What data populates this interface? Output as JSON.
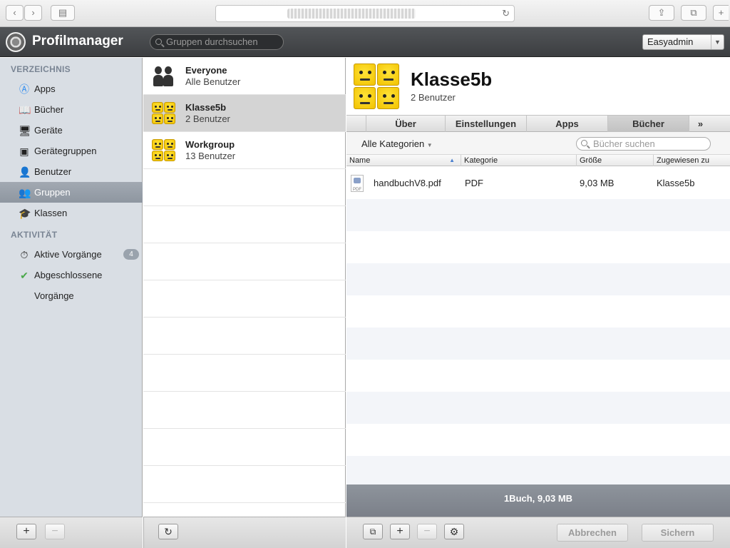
{
  "app": {
    "title": "Profilmanager",
    "search_placeholder": "Gruppen durchsuchen",
    "user": "Easyadmin"
  },
  "sidebar": {
    "sections": [
      {
        "label": "VERZEICHNIS"
      },
      {
        "label": "AKTIVITÄT"
      }
    ],
    "items": [
      {
        "label": "Apps",
        "icon": "app-store-icon"
      },
      {
        "label": "Bücher",
        "icon": "book-icon"
      },
      {
        "label": "Geräte",
        "icon": "monitor-icon"
      },
      {
        "label": "Gerätegruppen",
        "icon": "device-groups-icon"
      },
      {
        "label": "Benutzer",
        "icon": "user-icon"
      },
      {
        "label": "Gruppen",
        "icon": "group-icon",
        "selected": true
      },
      {
        "label": "Klassen",
        "icon": "graduation-cap-icon"
      },
      {
        "label": "Aktive Vorgänge",
        "icon": "clock-icon",
        "badge": "4"
      },
      {
        "label": "Abgeschlossene Vorgänge",
        "icon": "completed-icon"
      }
    ]
  },
  "groups": [
    {
      "name": "Everyone",
      "sub": "Alle Benutzer",
      "icon": "people-icon"
    },
    {
      "name": "Klasse5b",
      "sub": "2 Benutzer",
      "icon": "lego-faces-icon",
      "selected": true
    },
    {
      "name": "Workgroup",
      "sub": "13 Benutzer",
      "icon": "lego-faces-icon"
    }
  ],
  "detail": {
    "title": "Klasse5b",
    "subtitle": "2 Benutzer",
    "tabs": [
      "Über",
      "Einstellungen",
      "Apps",
      "Bücher",
      "»"
    ],
    "selected_tab": "Bücher",
    "category_filter": "Alle Kategorien",
    "search_placeholder": "Bücher suchen",
    "columns": [
      "Name",
      "Kategorie",
      "Größe",
      "Zugewiesen zu"
    ],
    "rows": [
      {
        "name": "handbuchV8.pdf",
        "category": "PDF",
        "size": "9,03 MB",
        "assigned": "Klasse5b"
      }
    ],
    "summary": "1Buch, 9,03 MB",
    "cancel_label": "Abbrechen",
    "save_label": "Sichern"
  }
}
